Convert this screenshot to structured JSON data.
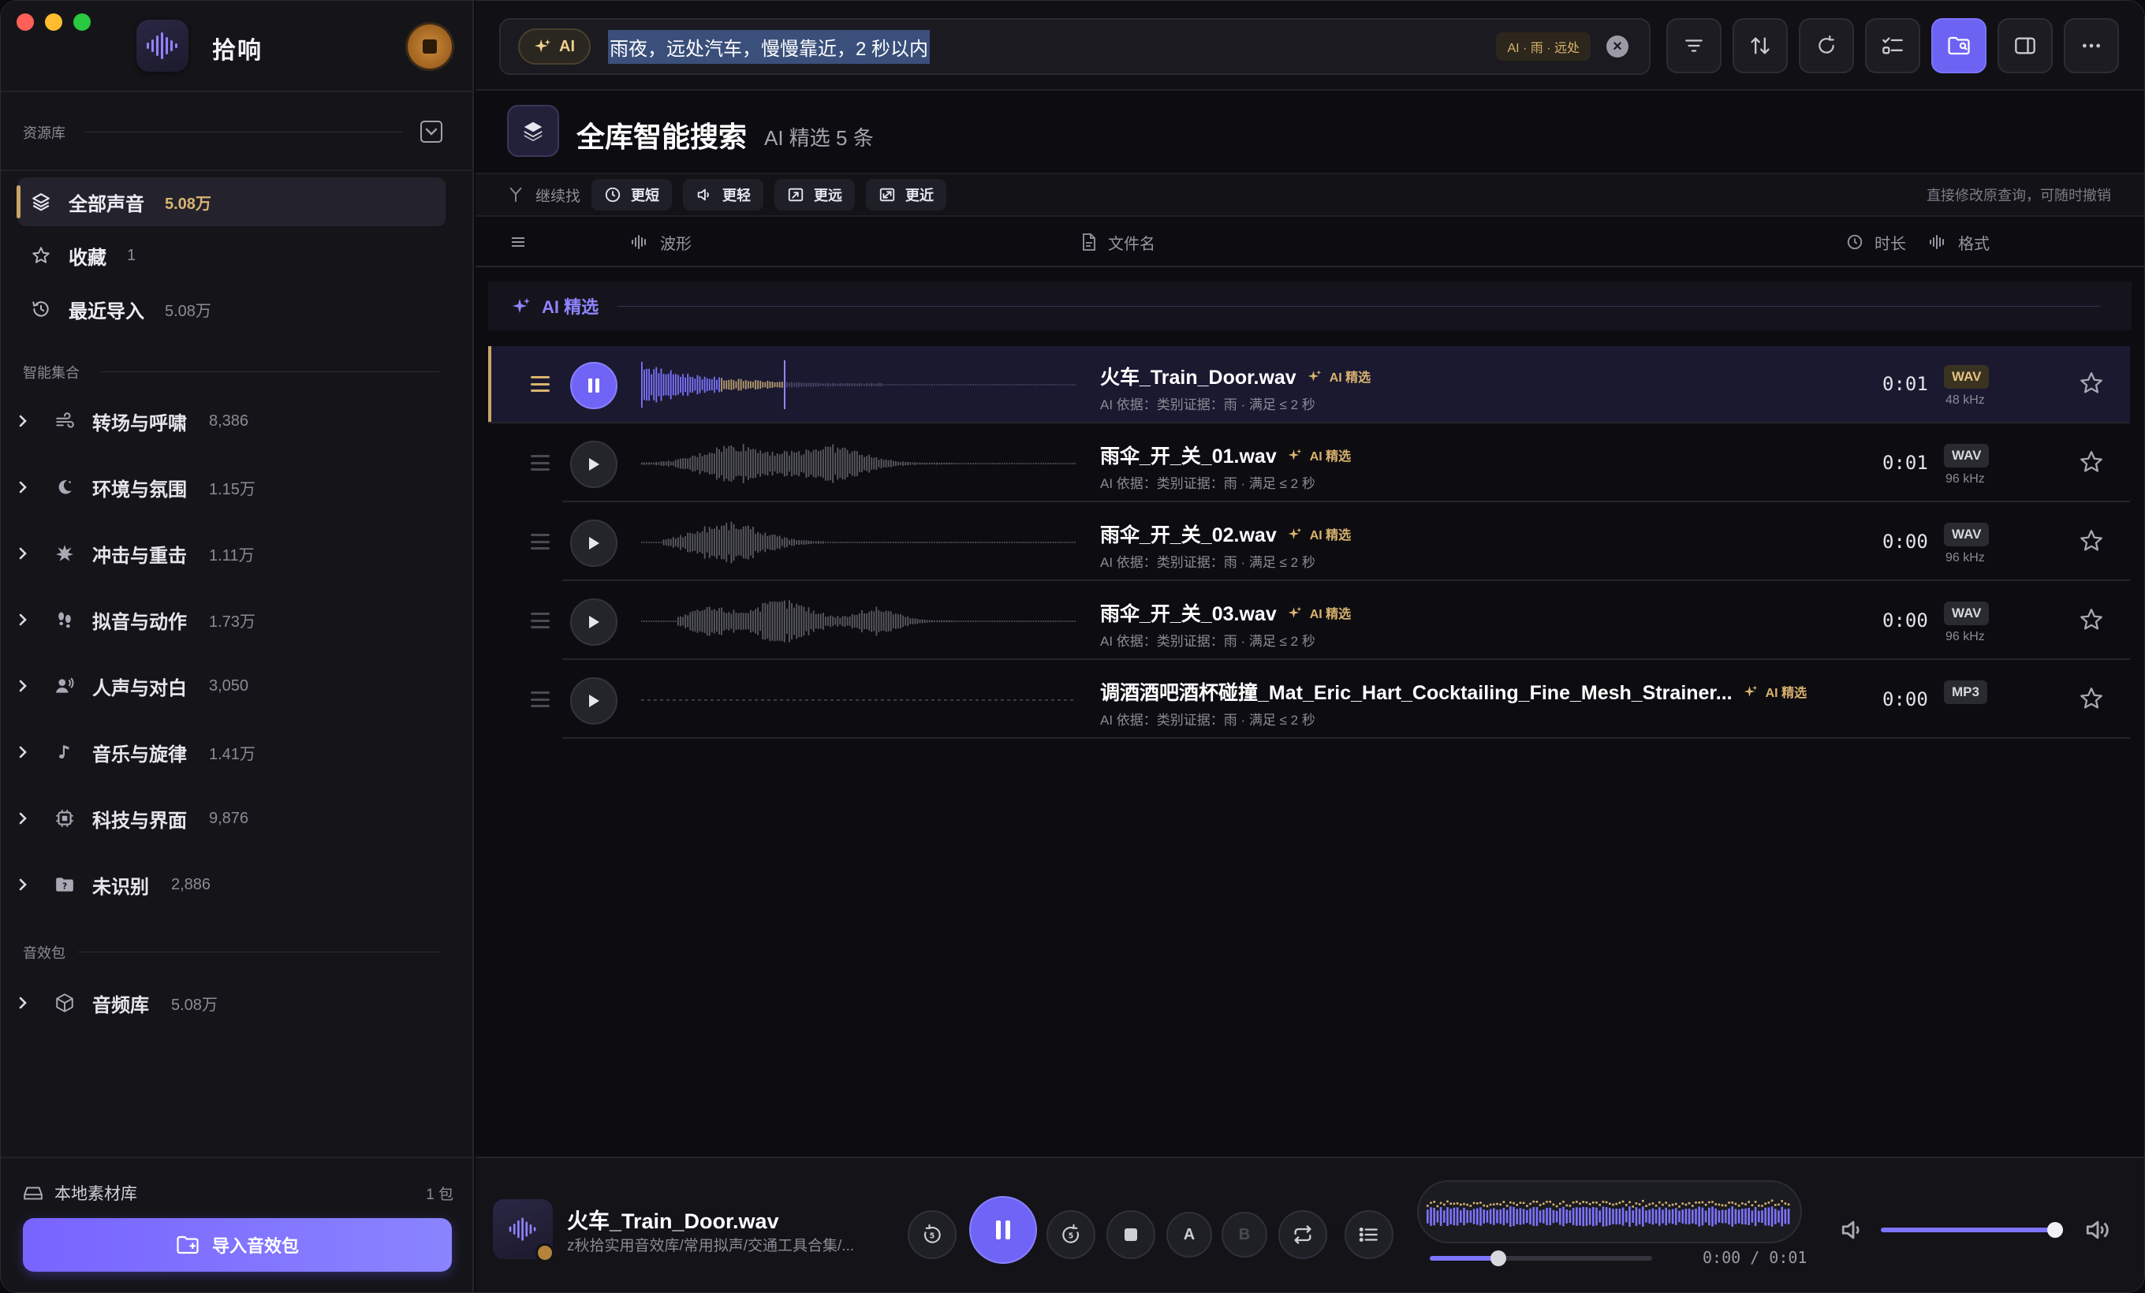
{
  "app": {
    "name": "拾响"
  },
  "sidebar": {
    "library_header": "资源库",
    "library_items": [
      {
        "label": "全部声音",
        "count": "5.08万",
        "icon": "layers-icon",
        "active": true
      },
      {
        "label": "收藏",
        "count": "1",
        "icon": "star-icon"
      },
      {
        "label": "最近导入",
        "count": "5.08万",
        "icon": "history-icon"
      }
    ],
    "smart_header": "智能集合",
    "smart_items": [
      {
        "label": "转场与呼啸",
        "count": "8,386",
        "icon": "wind-icon"
      },
      {
        "label": "环境与氛围",
        "count": "1.15万",
        "icon": "moon-icon"
      },
      {
        "label": "冲击与重击",
        "count": "1.11万",
        "icon": "burst-icon"
      },
      {
        "label": "拟音与动作",
        "count": "1.73万",
        "icon": "footprints-icon"
      },
      {
        "label": "人声与对白",
        "count": "3,050",
        "icon": "speaker-person-icon"
      },
      {
        "label": "音乐与旋律",
        "count": "1.41万",
        "icon": "music-note-icon"
      },
      {
        "label": "科技与界面",
        "count": "9,876",
        "icon": "chip-icon"
      },
      {
        "label": "未识别",
        "count": "2,886",
        "icon": "unknown-folder-icon"
      }
    ],
    "packs_header": "音效包",
    "pack_items": [
      {
        "label": "音频库",
        "count": "5.08万",
        "icon": "package-icon"
      }
    ],
    "local_label": "本地素材库",
    "local_count": "1 包",
    "import_label": "导入音效包"
  },
  "search": {
    "ai_label": "AI",
    "query": "雨夜，远处汽车，慢慢靠近，2 秒以内",
    "tag": "AI · 雨 · 远处"
  },
  "header": {
    "title": "全库智能搜索",
    "subtitle": "AI 精选 5 条"
  },
  "refine": {
    "label": "继续找",
    "chips": [
      "更短",
      "更轻",
      "更远",
      "更近"
    ],
    "hint": "直接修改原查询，可随时撤销"
  },
  "columns": {
    "waveform": "波形",
    "filename": "文件名",
    "duration": "时长",
    "format": "格式"
  },
  "group_label": "AI 精选",
  "rows": [
    {
      "name": "火车_Train_Door.wav",
      "tag": "AI 精选",
      "reason": "AI 依据：类别证据：雨 · 满足 ≤ 2 秒",
      "duration": "0:01",
      "format": "WAV",
      "rate": "48 kHz",
      "playing": true
    },
    {
      "name": "雨伞_开_关_01.wav",
      "tag": "AI 精选",
      "reason": "AI 依据：类别证据：雨 · 满足 ≤ 2 秒",
      "duration": "0:01",
      "format": "WAV",
      "rate": "96 kHz"
    },
    {
      "name": "雨伞_开_关_02.wav",
      "tag": "AI 精选",
      "reason": "AI 依据：类别证据：雨 · 满足 ≤ 2 秒",
      "duration": "0:00",
      "format": "WAV",
      "rate": "96 kHz"
    },
    {
      "name": "雨伞_开_关_03.wav",
      "tag": "AI 精选",
      "reason": "AI 依据：类别证据：雨 · 满足 ≤ 2 秒",
      "duration": "0:00",
      "format": "WAV",
      "rate": "96 kHz"
    },
    {
      "name": "调酒酒吧酒杯碰撞_Mat_Eric_Hart_Cocktailing_Fine_Mesh_Strainer...",
      "tag": "AI 精选",
      "reason": "AI 依据：类别证据：雨 · 满足 ≤ 2 秒",
      "duration": "0:00",
      "format": "MP3",
      "rate": ""
    }
  ],
  "player": {
    "title": "火车_Train_Door.wav",
    "path": "z秋拾实用音效库/常用拟声/交通工具合集/...",
    "a_label": "A",
    "b_label": "B",
    "time": "0:00 / 0:01",
    "seek_fraction": 0.31,
    "volume_fraction": 0.97
  },
  "colors": {
    "accent": "#6f64f5",
    "gold": "#d9b36e"
  }
}
